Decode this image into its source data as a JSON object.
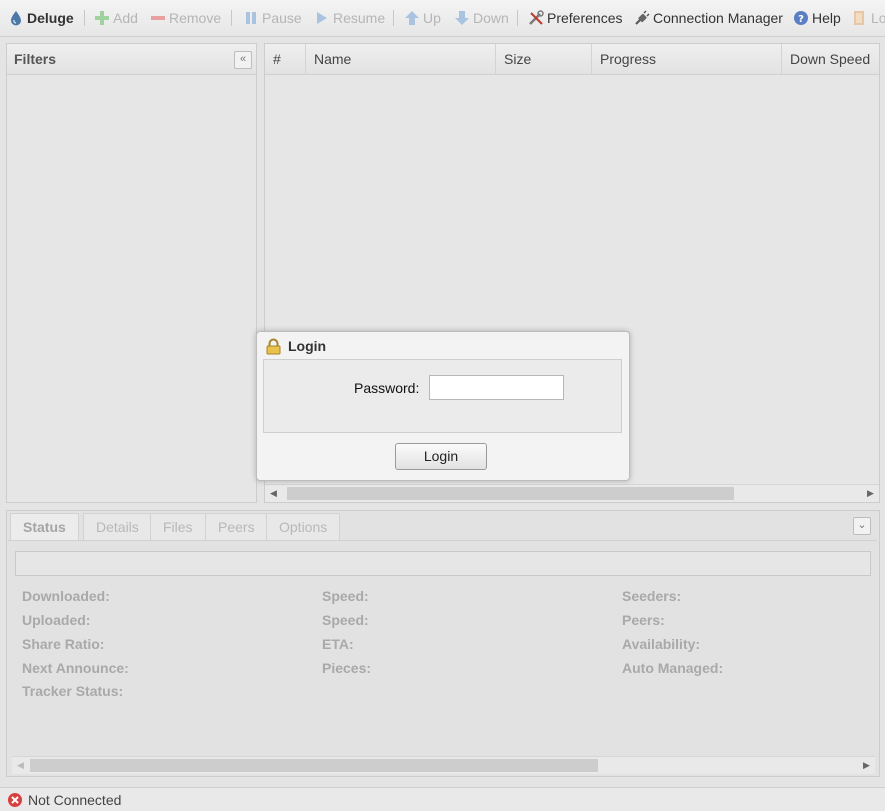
{
  "toolbar": {
    "app_name": "Deluge",
    "add": "Add",
    "remove": "Remove",
    "pause": "Pause",
    "resume": "Resume",
    "up": "Up",
    "down": "Down",
    "preferences": "Preferences",
    "connection_manager": "Connection Manager",
    "help": "Help",
    "logout_partial": "Lo"
  },
  "filters": {
    "title": "Filters",
    "collapse_icon": "double-chevron-left-icon"
  },
  "torrent_table": {
    "columns": [
      "#",
      "Name",
      "Size",
      "Progress",
      "Down Speed"
    ]
  },
  "details": {
    "tabs": [
      "Status",
      "Details",
      "Files",
      "Peers",
      "Options"
    ],
    "active_tab": "Status",
    "col1": [
      "Downloaded:",
      "Uploaded:",
      "Share Ratio:",
      "Next Announce:",
      "Tracker Status:"
    ],
    "col2": [
      "Speed:",
      "Speed:",
      "ETA:",
      "Pieces:"
    ],
    "col3": [
      "Seeders:",
      "Peers:",
      "Availability:",
      "Auto Managed:"
    ]
  },
  "login_dialog": {
    "title": "Login",
    "password_label": "Password:",
    "password_value": "",
    "button_label": "Login"
  },
  "statusbar": {
    "text": "Not Connected"
  },
  "colors": {
    "background": "#e4e4e4",
    "toolbar": "#efefef",
    "error_icon": "#d64040"
  }
}
